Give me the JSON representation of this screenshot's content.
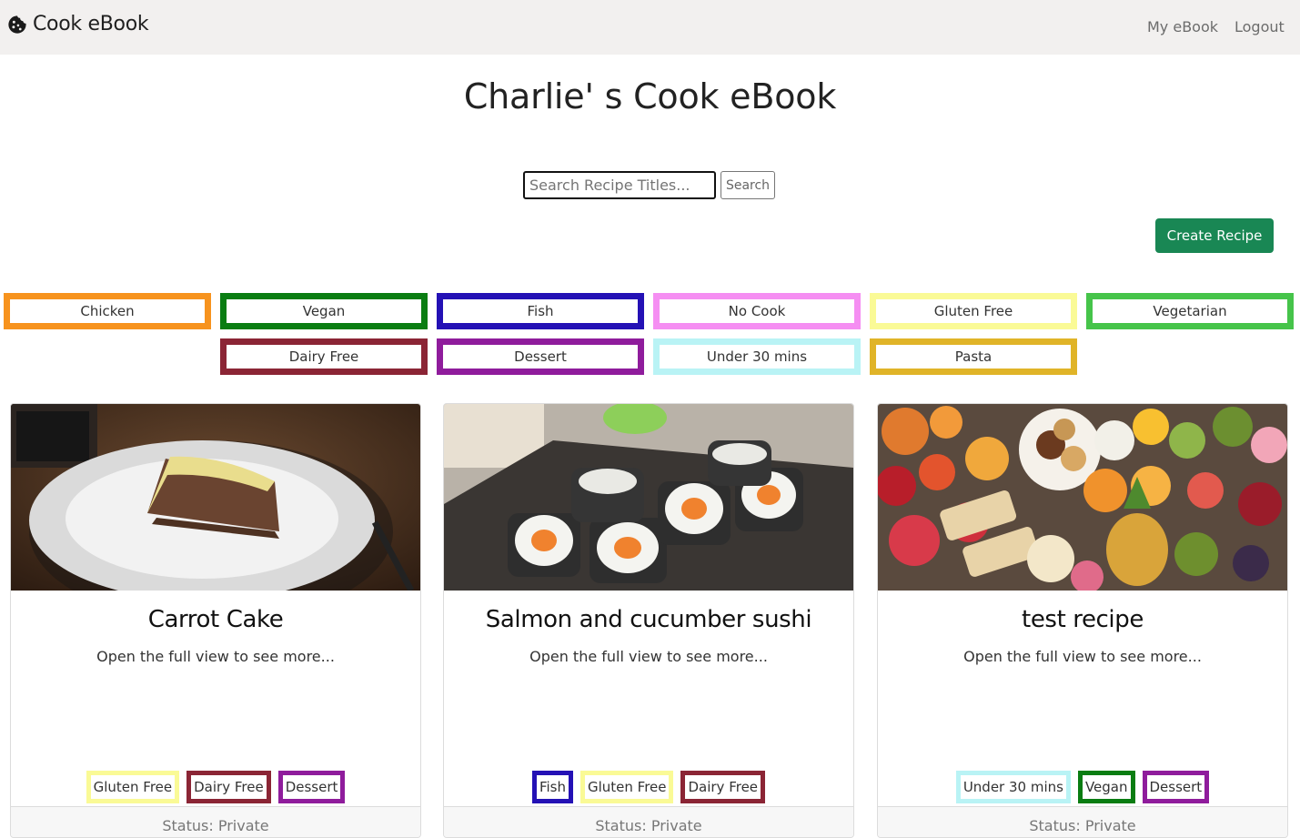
{
  "navbar": {
    "brand": "Cook eBook",
    "brand_icon": "cookie-icon",
    "links": [
      {
        "label": "My eBook"
      },
      {
        "label": "Logout"
      }
    ]
  },
  "page": {
    "title": "Charlie' s Cook eBook"
  },
  "search": {
    "placeholder": "Search Recipe Titles...",
    "button_label": "Search"
  },
  "create_button": "Create Recipe",
  "colors": {
    "navbar_bg": "#f2f0ef",
    "create_button": "#198754"
  },
  "tag_filters": [
    {
      "label": "Chicken",
      "color": "#f7931e"
    },
    {
      "label": "Vegan",
      "color": "#0a7d12"
    },
    {
      "label": "Fish",
      "color": "#2411b5"
    },
    {
      "label": "No Cook",
      "color": "#f58ef2"
    },
    {
      "label": "Gluten Free",
      "color": "#fafa96"
    },
    {
      "label": "Vegetarian",
      "color": "#46c44a"
    },
    {
      "label": "Dairy Free",
      "color": "#8b2535"
    },
    {
      "label": "Dessert",
      "color": "#8f1c9c"
    },
    {
      "label": "Under 30 mins",
      "color": "#b9f3f5"
    },
    {
      "label": "Pasta",
      "color": "#e0b428"
    }
  ],
  "recipes": [
    {
      "title": "Carrot Cake",
      "description": "Open the full view to see more...",
      "status": "Status: Private",
      "tags": [
        {
          "label": "Gluten Free",
          "color": "#fafa96"
        },
        {
          "label": "Dairy Free",
          "color": "#8b2535"
        },
        {
          "label": "Dessert",
          "color": "#8f1c9c"
        }
      ]
    },
    {
      "title": "Salmon and cucumber sushi",
      "description": "Open the full view to see more...",
      "status": "Status: Private",
      "tags": [
        {
          "label": "Fish",
          "color": "#2411b5"
        },
        {
          "label": "Gluten Free",
          "color": "#fafa96"
        },
        {
          "label": "Dairy Free",
          "color": "#8b2535"
        }
      ]
    },
    {
      "title": "test recipe",
      "description": "Open the full view to see more...",
      "status": "Status: Private",
      "tags": [
        {
          "label": "Under 30 mins",
          "color": "#b9f3f5"
        },
        {
          "label": "Vegan",
          "color": "#0a7d12"
        },
        {
          "label": "Dessert",
          "color": "#8f1c9c"
        }
      ]
    }
  ]
}
